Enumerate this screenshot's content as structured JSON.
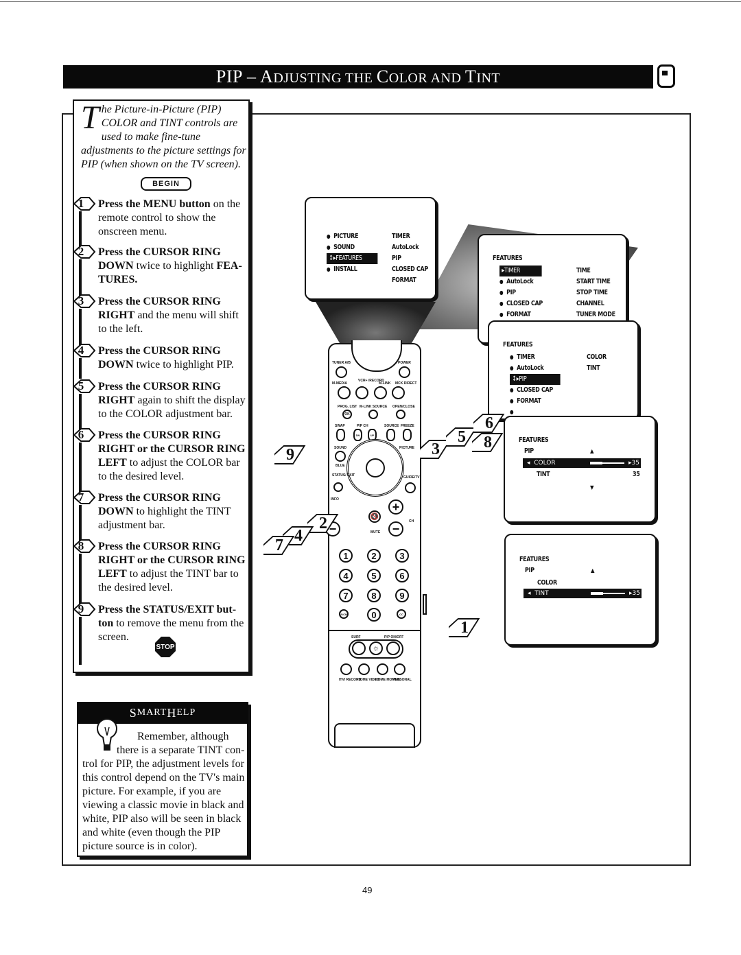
{
  "page": {
    "title_main": "PIP – A",
    "title_parts": [
      "PIP – ",
      "A",
      "DJUSTING THE ",
      "C",
      "OLOR AND ",
      "T",
      "INT"
    ],
    "title_full": "PIP – Adjusting the Color and Tint",
    "page_number": "49"
  },
  "intro": {
    "dropcap": "T",
    "text": "he Picture-in-Picture (PIP) COLOR and TINT controls are used to make fine-tune adjustments to the picture settings for PIP (when shown on the TV screen).",
    "begin_label": "BEGIN"
  },
  "steps": [
    {
      "num": "1",
      "bold": "Press the MENU button",
      "rest": " on the remote control to show the onscreen menu."
    },
    {
      "num": "2",
      "bold": "Press the CURSOR RING DOWN",
      "rest": " twice to highlight ",
      "bold2": "FEA-TURES."
    },
    {
      "num": "3",
      "bold": "Press the CURSOR RING RIGHT",
      "rest": " and the menu will shift to the left."
    },
    {
      "num": "4",
      "bold": "Press the CURSOR RING DOWN",
      "rest": " twice to highlight PIP."
    },
    {
      "num": "5",
      "bold": "Press the CURSOR RING RIGHT",
      "rest": " again to shift the display to the COLOR adjustment bar."
    },
    {
      "num": "6",
      "bold": "Press the CURSOR RING RIGHT or the CURSOR RING LEFT",
      "rest": " to adjust the COLOR bar to the desired level."
    },
    {
      "num": "7",
      "bold": "Press the CURSOR RING DOWN",
      "rest": " to highlight the TINT adjustment bar."
    },
    {
      "num": "8",
      "bold": "Press the CURSOR RING RIGHT or the CURSOR RING LEFT",
      "rest": " to adjust the TINT bar to the desired level."
    },
    {
      "num": "9",
      "bold": "Press the STATUS/EXIT but-ton",
      "rest": " to remove the menu from the screen."
    }
  ],
  "stop_label": "STOP",
  "smart_help": {
    "title_a": "S",
    "title_b": "MART ",
    "title_c": "H",
    "title_d": "ELP",
    "line1": "Remember, although",
    "line2": "there is a separate TINT con-",
    "rest": "trol for PIP, the adjustment levels for this control depend on the TV's main picture.  For example, if you are viewing a classic movie in black and white, PIP also will be seen in black and white (even though the PIP picture source is in color)."
  },
  "screens": {
    "main_menu": {
      "left": [
        "PICTURE",
        "SOUND",
        "FEATURES",
        "INSTALL"
      ],
      "highlighted": "FEATURES",
      "right": [
        "TIMER",
        "AutoLock",
        "PIP",
        "CLOSED CAP",
        "FORMAT"
      ]
    },
    "features_menu": {
      "title": "FEATURES",
      "left": [
        "TIMER",
        "AutoLock",
        "PIP",
        "CLOSED CAP",
        "FORMAT"
      ],
      "highlighted": "TIMER",
      "right": [
        "TIME",
        "START TIME",
        "STOP TIME",
        "CHANNEL",
        "TUNER MODE"
      ]
    },
    "pip_menu": {
      "title": "FEATURES",
      "left": [
        "TIMER",
        "AutoLock",
        "PIP",
        "CLOSED CAP",
        "FORMAT",
        ""
      ],
      "highlighted": "PIP",
      "right": [
        "COLOR",
        "TINT"
      ]
    },
    "color_adjust": {
      "title": "FEATURES",
      "sub": "PIP",
      "selected": "COLOR",
      "selected_value": "35",
      "other": "TINT",
      "other_value": "35",
      "level": 0.35
    },
    "tint_adjust": {
      "title": "FEATURES",
      "sub": "PIP",
      "other": "COLOR",
      "selected": "TINT",
      "selected_value": "35",
      "level": 0.35
    }
  },
  "remote": {
    "labels": {
      "tuner": "TUNER A/B",
      "power": "POWER",
      "vcr": "VCR+ /RECORD",
      "mmedia": "M-MEDIA",
      "mlink": "M-LINK",
      "mckdir": "MCK DIRECT",
      "proglist": "PROG. LIST",
      "mlinksrc": "M-LINK SOURCE",
      "openclose": "OPEN/CLOSE",
      "ok": "OK",
      "swap": "SWAP",
      "pipch": "PIP CH",
      "dn": "DN",
      "up": "UP",
      "source": "SOURCE",
      "freeze": "FREEZE",
      "sound": "SOUND",
      "picture": "PICTURE",
      "blue": "BLUE",
      "status": "STATUS/ EXIT",
      "info": "INFO",
      "guide": "GUIDE/TV",
      "mute": "MUTE",
      "ch": "CH",
      "surf": "SURF",
      "piponoff": "PIP ON/OFF",
      "itv": "ITV/ RECORD",
      "homevideo": "HOME VIDEO",
      "homemovies": "HOME MOVIES",
      "personal": "PERSONAL",
      "ach": "A/CH",
      "cc": "CC"
    },
    "digits": [
      "1",
      "2",
      "3",
      "4",
      "5",
      "6",
      "7",
      "8",
      "9",
      "0"
    ]
  },
  "callouts": [
    "1",
    "2",
    "3",
    "4",
    "5",
    "6",
    "7",
    "8",
    "9"
  ]
}
